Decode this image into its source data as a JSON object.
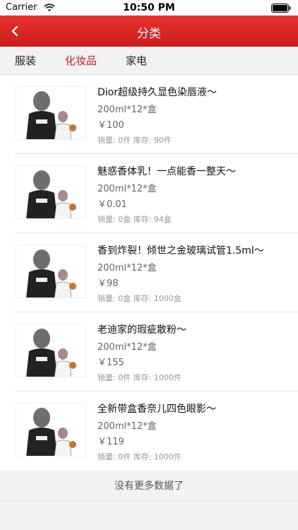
{
  "status": {
    "carrier": "Carrier",
    "time": "10:50 PM"
  },
  "nav": {
    "title": "分类",
    "back_icon": "chevron-left-icon"
  },
  "tabs": [
    {
      "label": "服装",
      "active": false
    },
    {
      "label": "化妆品",
      "active": true
    },
    {
      "label": "家电",
      "active": false
    }
  ],
  "products": [
    {
      "title": "Dior超级持久显色染唇液～",
      "spec": "200ml*12*盒",
      "price": "￥100",
      "meta": "销量: 0件 库存: 90件"
    },
    {
      "title": "魅惑香体乳！一点能香一整天～",
      "spec": "200ml*12*盒",
      "price": "￥0.01",
      "meta": "销量: 0盒 库存: 94盒"
    },
    {
      "title": "香到炸裂！倾世之金玻璃试管1.5ml～",
      "spec": "200ml*12*盒",
      "price": "￥98",
      "meta": "销量: 0盒 库存: 1000盒"
    },
    {
      "title": "老迪家的瑕疵散粉～",
      "spec": "200ml*12*盒",
      "price": "￥155",
      "meta": "销量: 0件 库存: 1000件"
    },
    {
      "title": "全新带盒香奈儿四色眼影～",
      "spec": "200ml*12*盒",
      "price": "￥119",
      "meta": "销量: 0件 库存: 1000件"
    }
  ],
  "footer": {
    "no_more": "没有更多数据了"
  },
  "colors": {
    "accent": "#d02020",
    "nav_bg": "#e02a28"
  }
}
